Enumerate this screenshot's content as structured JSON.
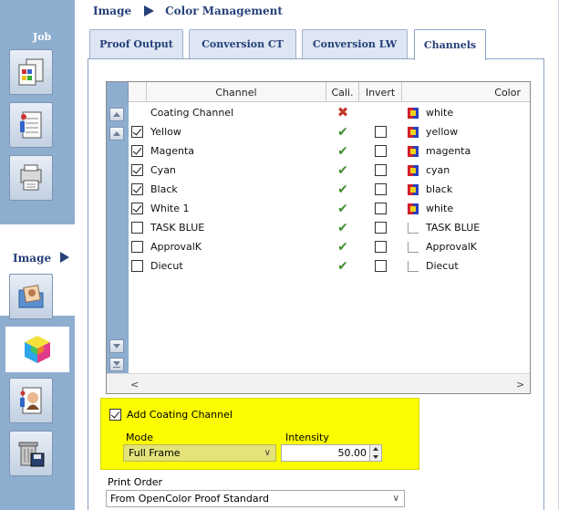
{
  "sidebar": {
    "job_label": "Job",
    "image_label": "Image",
    "job_buttons": [
      {
        "icon": "proof-output-icon"
      },
      {
        "icon": "job-layout-icon"
      },
      {
        "icon": "printer-icon"
      }
    ],
    "image_buttons": [
      {
        "icon": "image-folder-icon"
      },
      {
        "icon": "color-cube-icon"
      },
      {
        "icon": "portrait-icon"
      },
      {
        "icon": "trash-save-icon"
      }
    ]
  },
  "breadcrumb": {
    "section": "Image",
    "page": "Color Management"
  },
  "tabs": [
    {
      "label": "Proof Output"
    },
    {
      "label": "Conversion CT"
    },
    {
      "label": "Conversion LW"
    },
    {
      "label": "Channels",
      "active": true
    }
  ],
  "table": {
    "columns": {
      "channel": "Channel",
      "cali": "Cali.",
      "invert": "Invert",
      "color": "Color"
    },
    "rows": [
      {
        "enabled": null,
        "name": "Coating Channel",
        "cali": "fail",
        "invert": null,
        "swatch": "multi",
        "color": "white"
      },
      {
        "enabled": true,
        "name": "Yellow",
        "cali": "ok",
        "invert": false,
        "swatch": "multi",
        "color": "yellow"
      },
      {
        "enabled": true,
        "name": "Magenta",
        "cali": "ok",
        "invert": false,
        "swatch": "multi",
        "color": "magenta"
      },
      {
        "enabled": true,
        "name": "Cyan",
        "cali": "ok",
        "invert": false,
        "swatch": "multi",
        "color": "cyan"
      },
      {
        "enabled": true,
        "name": "Black",
        "cali": "ok",
        "invert": false,
        "swatch": "multi",
        "color": "black"
      },
      {
        "enabled": true,
        "name": "White 1",
        "cali": "ok",
        "invert": false,
        "swatch": "multi",
        "color": "white"
      },
      {
        "enabled": false,
        "name": "TASK BLUE",
        "cali": "ok",
        "invert": false,
        "swatch": "spot",
        "color": "TASK BLUE"
      },
      {
        "enabled": false,
        "name": "ApprovalK",
        "cali": "ok",
        "invert": false,
        "swatch": "spot",
        "color": "ApprovalK"
      },
      {
        "enabled": false,
        "name": "Diecut",
        "cali": "ok",
        "invert": false,
        "swatch": "spot",
        "color": "Diecut"
      }
    ]
  },
  "coating": {
    "add_label": "Add Coating Channel",
    "checked": true,
    "mode_label": "Mode",
    "mode_value": "Full Frame",
    "intensity_label": "Intensity",
    "intensity_value": "50.00"
  },
  "print_order": {
    "label": "Print Order",
    "value": "From OpenColor Proof Standard"
  },
  "colors": {
    "sidebar": "#8eaecf",
    "accent_text": "#26407a",
    "highlight": "#fcfc00"
  }
}
